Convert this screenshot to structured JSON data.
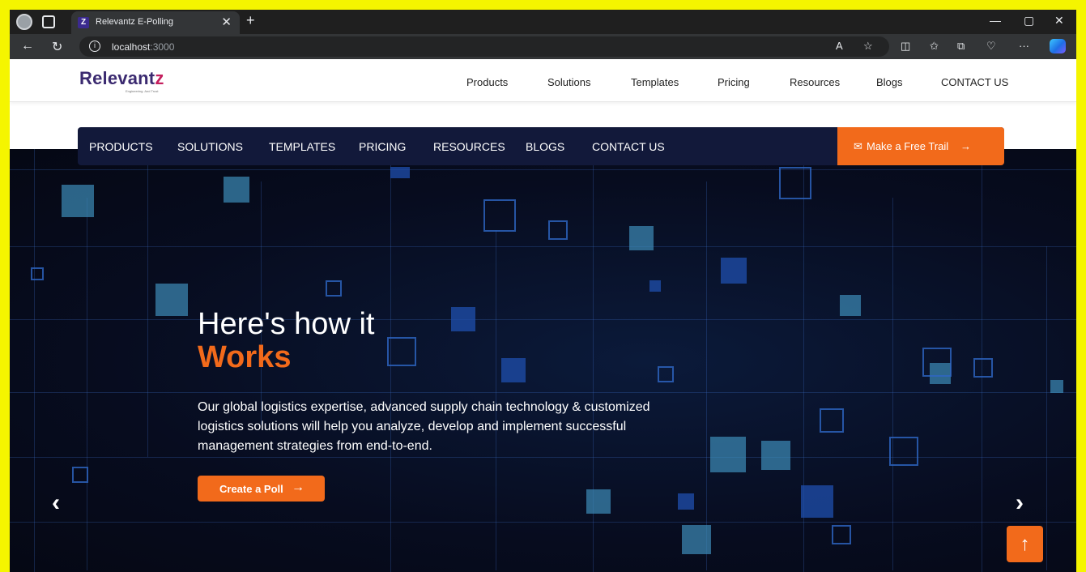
{
  "browser": {
    "tab_title": "Relevantz E-Polling",
    "tab_close": "✕",
    "new_tab": "+",
    "favicon_letter": "Z",
    "url_host": "localhost",
    "url_port": ":3000",
    "icons": [
      "back-icon",
      "refresh-icon",
      "info-icon",
      "read-aloud-icon",
      "favorite-icon",
      "split-screen-icon",
      "favorites-icon",
      "collections-icon",
      "health-icon",
      "more-icon",
      "copilot-icon"
    ],
    "window_controls": [
      "—",
      "▢",
      "✕"
    ]
  },
  "site": {
    "logo": {
      "main": "Relevant",
      "accent": "z",
      "tagline": "Engineering. And Trust"
    },
    "top_nav": [
      "Products",
      "Solutions",
      "Templates",
      "Pricing",
      "Resources",
      "Blogs",
      "CONTACT US"
    ],
    "secondary_nav": [
      "PRODUCTS",
      "SOLUTIONS",
      "TEMPLATES",
      "PRICING",
      "RESOURCES",
      "BLOGS",
      "CONTACT US"
    ],
    "trial_button": "Make a Free Trail",
    "hero": {
      "title_line1": "Here's how it",
      "title_line2": "Works",
      "description": "Our global logistics expertise, advanced supply chain technology & customized logistics solutions will help you analyze, develop and implement successful management strategies from end-to-end.",
      "cta": "Create a Poll",
      "prev": "‹",
      "next": "›"
    },
    "scroll_top": "↑",
    "colors": {
      "accent": "#f26a1b",
      "nav_bg": "#12193a",
      "brand": "#3b2a70"
    }
  }
}
